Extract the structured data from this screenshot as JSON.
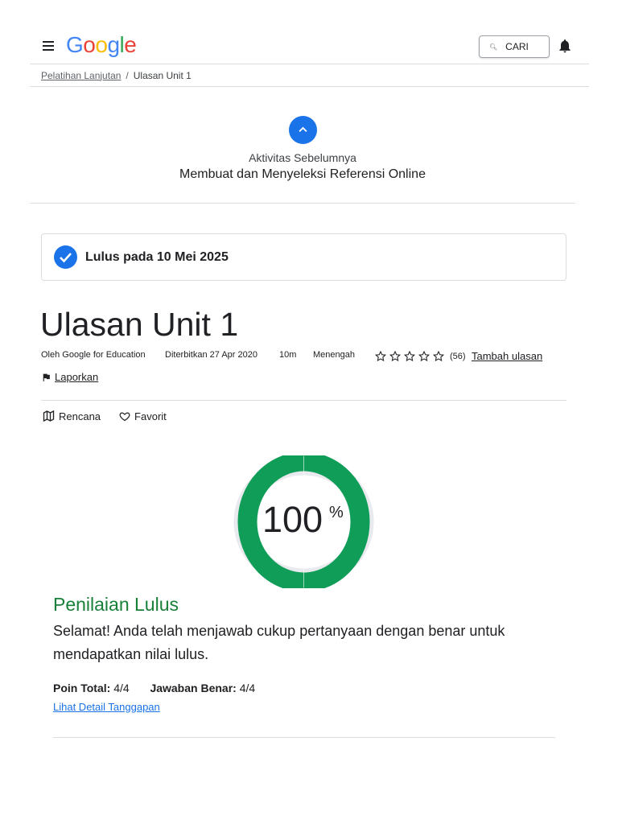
{
  "header": {
    "logo_letters": [
      {
        "char": "G",
        "color": "#4285f4"
      },
      {
        "char": "o",
        "color": "#ea4335"
      },
      {
        "char": "o",
        "color": "#fbbc05"
      },
      {
        "char": "g",
        "color": "#4285f4"
      },
      {
        "char": "l",
        "color": "#34a853"
      },
      {
        "char": "e",
        "color": "#ea4335"
      }
    ],
    "search_label": "CARI",
    "menu_icon": "hamburger-menu-icon",
    "notification_icon": "bell-icon"
  },
  "breadcrumb": {
    "parent": "Pelatihan Lanjutan",
    "separator": "/",
    "current": "Ulasan Unit 1"
  },
  "previous_activity": {
    "label": "Aktivitas Sebelumnya",
    "title": "Membuat dan Menyeleksi Referensi Online"
  },
  "pass_status": {
    "text": "Lulus pada 10 Mei 2025"
  },
  "page": {
    "title": "Ulasan Unit 1",
    "author": "Oleh Google for Education",
    "published": "Diterbitkan 27 Apr 2020",
    "duration": "10m",
    "level": "Menengah",
    "rating_stars": 0,
    "rating_max": 5,
    "review_count": "(56)",
    "add_review_label": "Tambah ulasan",
    "report_label": "Laporkan",
    "plan_label": "Rencana",
    "favorite_label": "Favorit"
  },
  "result": {
    "score_value": "100",
    "score_unit": "%",
    "score_fraction": 1.0,
    "accent_color": "#0f9d58",
    "title": "Penilaian Lulus",
    "message": "Selamat! Anda telah menjawab cukup pertanyaan dengan benar untuk mendapatkan nilai lulus.",
    "points_label": "Poin Total:",
    "points_value": "4/4",
    "correct_label": "Jawaban Benar:",
    "correct_value": "4/4",
    "detail_link": "Lihat Detail Tanggapan"
  },
  "colors": {
    "primary_blue": "#1a73e8",
    "pass_green": "#188038",
    "text": "#202124",
    "divider": "#dadce0"
  }
}
